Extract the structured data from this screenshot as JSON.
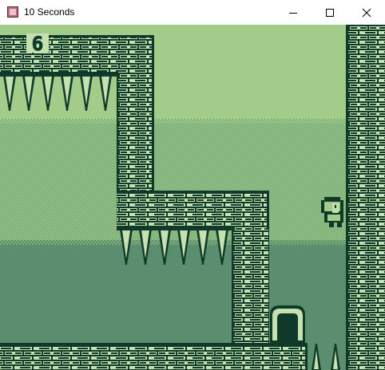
{
  "window": {
    "title": "10 Seconds",
    "controls": {
      "minimize": "minimize",
      "maximize": "maximize",
      "close": "close"
    }
  },
  "hud": {
    "counter": "6"
  },
  "palette": {
    "lightest": "#a3cc8a",
    "light": "#7eb07a",
    "mid": "#5a8e6e",
    "dark": "#0f3a2a",
    "brick_face": "#c6e1b0"
  },
  "icons": {
    "app": "app-icon",
    "minimize": "minimize-icon",
    "maximize": "maximize-icon",
    "close": "close-icon"
  }
}
